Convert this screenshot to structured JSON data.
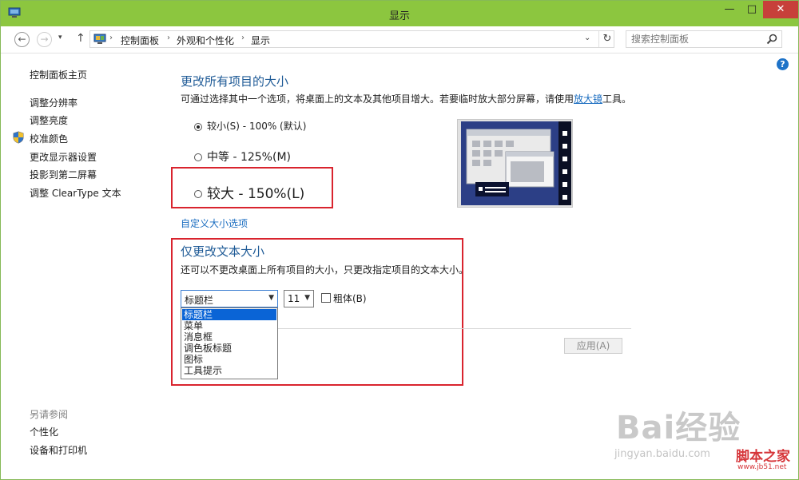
{
  "window": {
    "title": "显示",
    "minimize": "—",
    "maximize": "□",
    "close": "✕"
  },
  "nav": {
    "back": "←",
    "forward": "→",
    "up": "↑",
    "dropdown": "▾",
    "breadcrumb": [
      "控制面板",
      "外观和个性化",
      "显示"
    ],
    "separator": "›",
    "address_dropdown": "⌄",
    "refresh": "↻",
    "search_placeholder": "搜索控制面板"
  },
  "help": "?",
  "sidebar": {
    "home": "控制面板主页",
    "links": [
      "调整分辨率",
      "调整亮度",
      "校准颜色",
      "更改显示器设置",
      "投影到第二屏幕",
      "调整 ClearType 文本"
    ],
    "see_also_title": "另请参阅",
    "see_also": [
      "个性化",
      "设备和打印机"
    ]
  },
  "size_section": {
    "heading": "更改所有项目的大小",
    "desc_before": "可通过选择其中一个选项，将桌面上的文本及其他项目增大。若要临时放大部分屏幕，请使用",
    "desc_link": "放大镜",
    "desc_after": "工具。",
    "options": [
      {
        "label": "较小(S) - 100% (默认)",
        "selected": true
      },
      {
        "label": "中等 - 125%(M)",
        "selected": false
      },
      {
        "label": "较大 - 150%(L)",
        "selected": false
      }
    ],
    "custom_link": "自定义大小选项"
  },
  "text_section": {
    "heading": "仅更改文本大小",
    "desc": "还可以不更改桌面上所有项目的大小，只更改指定项目的文本大小。",
    "item_select": "标题栏",
    "size_select": "11",
    "bold_label": "粗体(B)",
    "bold_checked": false,
    "dropdown_items": [
      "标题栏",
      "菜单",
      "消息框",
      "调色板标题",
      "图标",
      "工具提示"
    ],
    "dropdown_selected_index": 0,
    "apply_label": "应用(A)"
  },
  "watermarks": {
    "baidu": "Bai经验",
    "baidu_url": "jingyan.baidu.com",
    "site": "脚本之家",
    "site_url": "www.jb51.net"
  },
  "colors": {
    "titlebar": "#8cc63f",
    "close": "#c7403a",
    "link": "#1a6dc0",
    "heading": "#1e5a96",
    "highlight": "#d9242e",
    "selection": "#0a64d6"
  }
}
